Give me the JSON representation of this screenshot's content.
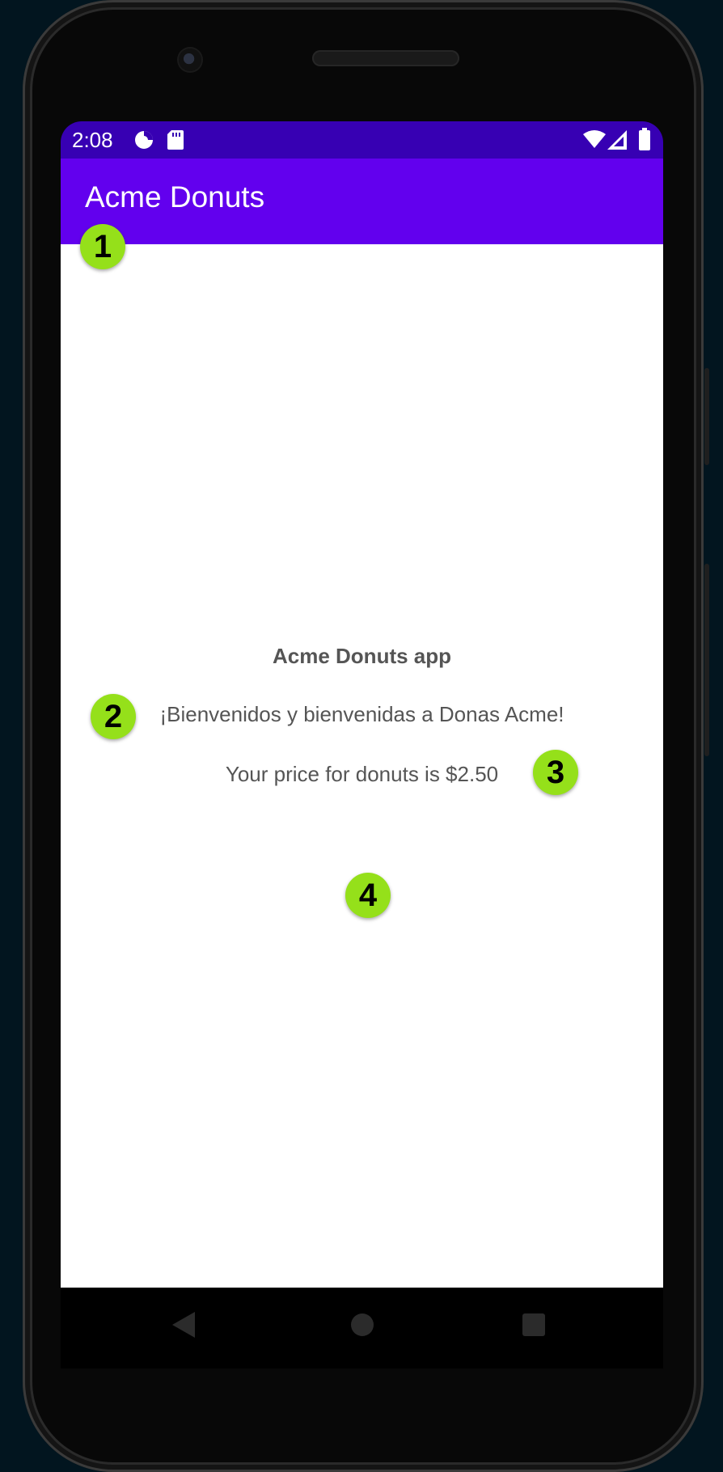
{
  "status_bar": {
    "time": "2:08",
    "icons": [
      "data-saver-icon",
      "sd-card-icon",
      "wifi-icon",
      "signal-icon",
      "battery-icon"
    ]
  },
  "toolbar": {
    "title": "Acme Donuts",
    "color": "#6200ee",
    "status_color": "#3700b3"
  },
  "content": {
    "app_title": "Acme Donuts app",
    "welcome": "¡Bienvenidos y bienvenidas a Donas Acme!",
    "price": "Your price for donuts is $2.50"
  },
  "callouts": {
    "badge1": "1",
    "badge2": "2",
    "badge3": "3",
    "badge4": "4",
    "color": "#95e01a"
  },
  "navigation": {
    "icons": [
      "back-icon",
      "home-icon",
      "recents-icon"
    ]
  }
}
